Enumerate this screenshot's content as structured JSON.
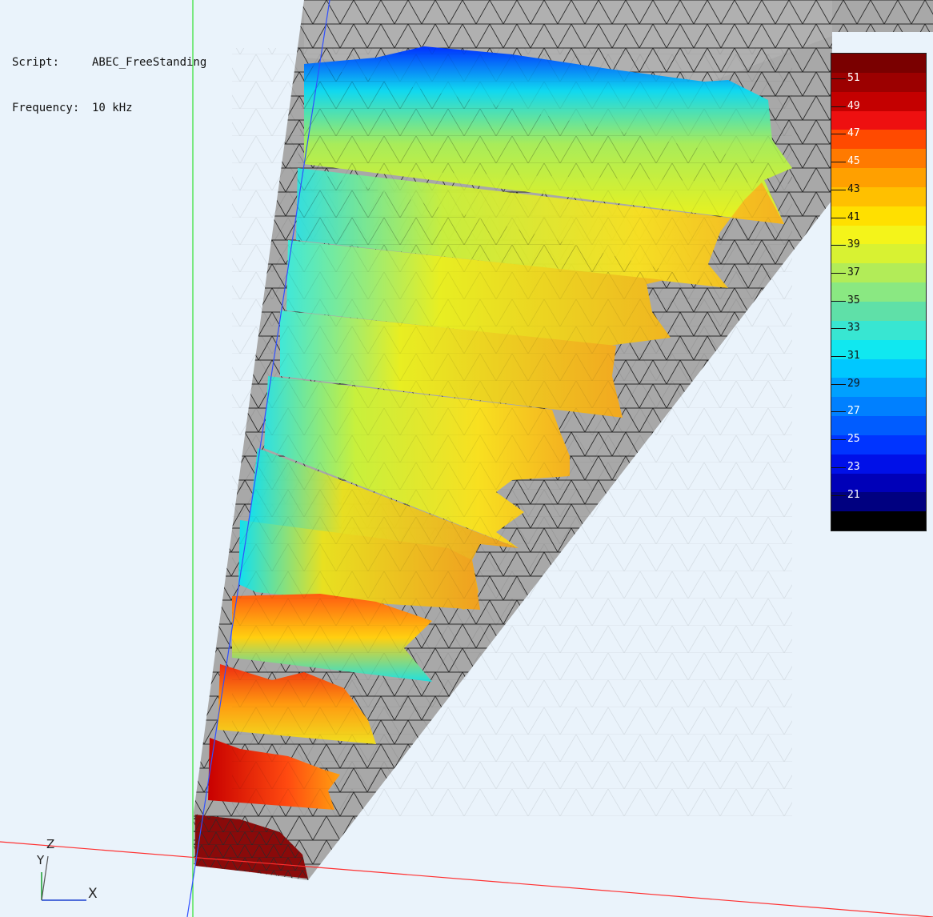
{
  "info": {
    "script_label": "Script:",
    "script_value": "ABEC_FreeStanding",
    "frequency_label": "Frequency:",
    "frequency_value": "10 kHz"
  },
  "legend": {
    "labels": [
      "51",
      "49",
      "47",
      "45",
      "43",
      "41",
      "39",
      "37",
      "35",
      "33",
      "31",
      "29",
      "27",
      "25",
      "23",
      "21"
    ],
    "colors_top_to_bottom": [
      "#7a0000",
      "#9c0000",
      "#c40000",
      "#ee1010",
      "#ff4a00",
      "#ff7a00",
      "#ffa000",
      "#ffc000",
      "#ffe000",
      "#f4f41a",
      "#d8f232",
      "#b2ec58",
      "#8ae882",
      "#5fe0a8",
      "#38e6d2",
      "#10e8f0",
      "#00c8ff",
      "#00a0ff",
      "#0080ff",
      "#005cff",
      "#0034ff",
      "#0010e8",
      "#0000b8",
      "#000080",
      "#000000"
    ]
  },
  "axes": {
    "x_label": "X",
    "y_label": "Y",
    "z_label": "Z"
  },
  "colors": {
    "background": "#eaf3fb",
    "mesh": "#a8a8a8",
    "mesh_line": "#2a2a2a",
    "axis_red": "#ff3030",
    "axis_green": "#30e030",
    "axis_blue": "#3050ff",
    "source_red": "#8a0a0a"
  }
}
